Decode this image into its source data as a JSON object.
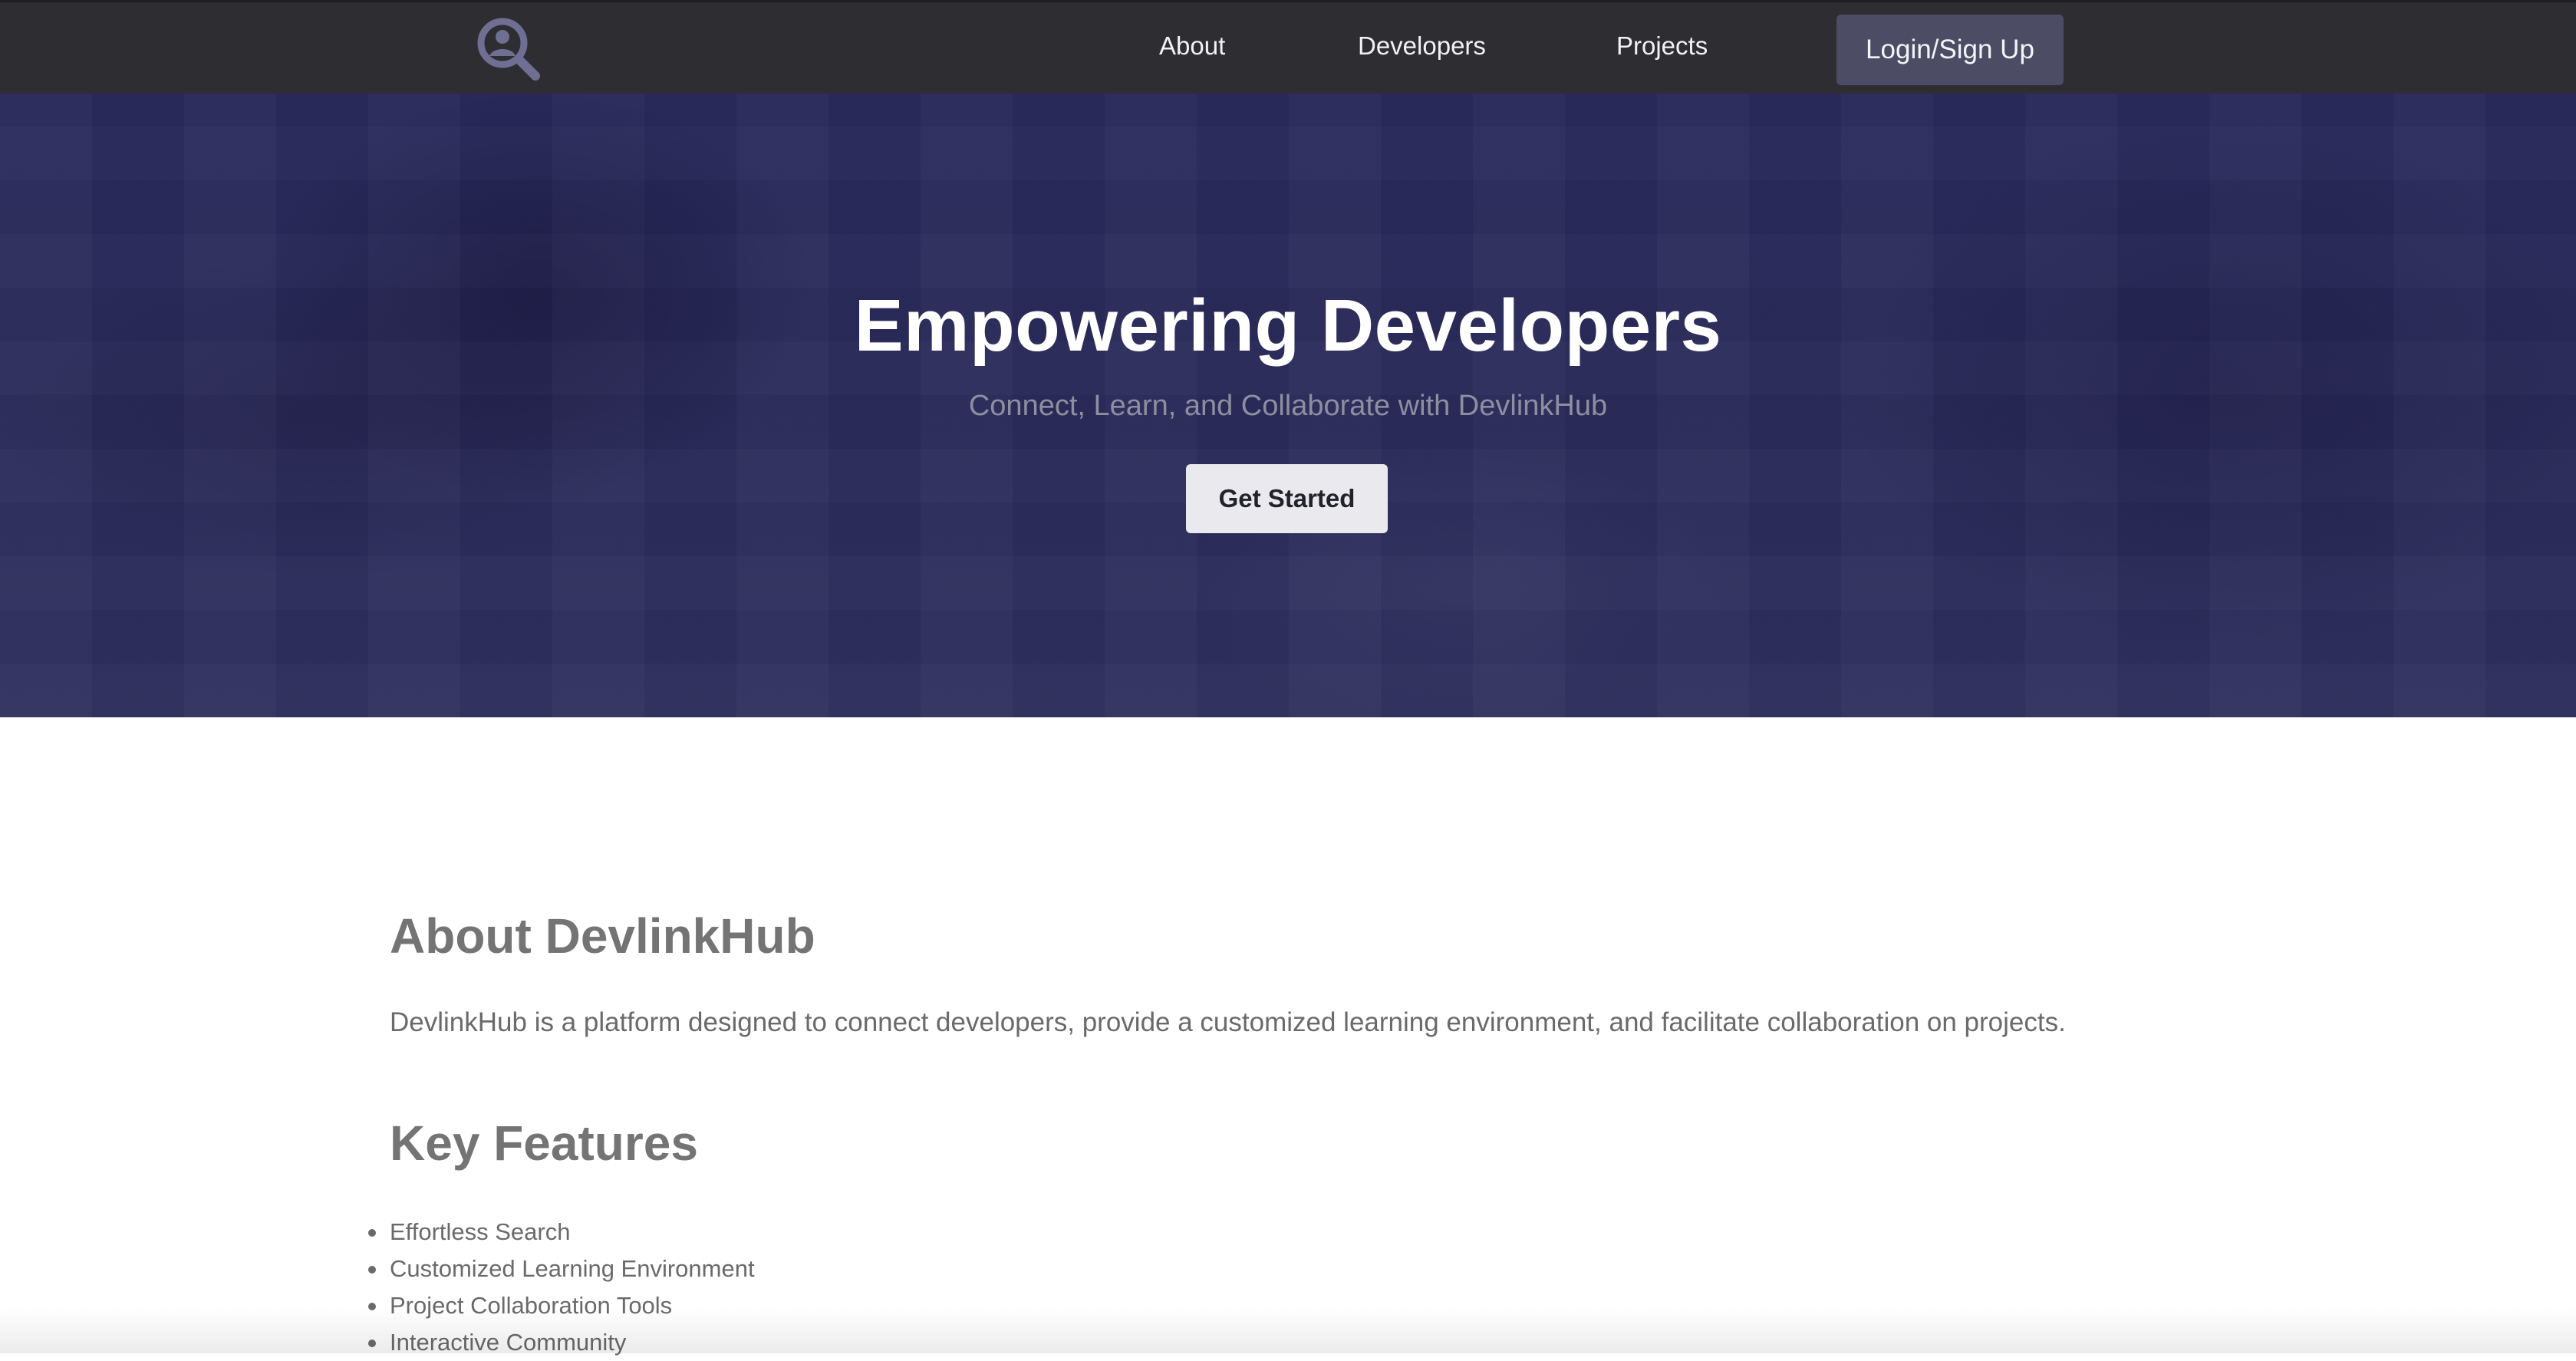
{
  "nav": {
    "logo_icon": "magnifier-user-icon",
    "links": [
      "About",
      "Developers",
      "Projects"
    ],
    "login_label": "Login/Sign Up"
  },
  "hero": {
    "title": "Empowering Developers",
    "subtitle": "Connect, Learn, and Collaborate with DevlinkHub",
    "cta_label": "Get Started"
  },
  "about": {
    "heading": "About DevlinkHub",
    "text": "DevlinkHub is a platform designed to connect developers, provide a customized learning environment, and facilitate collaboration on projects."
  },
  "features": {
    "heading": "Key Features",
    "items": [
      "Effortless Search",
      "Customized Learning Environment",
      "Project Collaboration Tools",
      "Interactive Community"
    ]
  },
  "colors": {
    "navbar_bg": "#2d2d32",
    "hero_bg": "#2b2b5a",
    "login_bg": "#4c4d64",
    "accent_logo": "#6e6f92",
    "text_gray": "#6a6a6a"
  }
}
